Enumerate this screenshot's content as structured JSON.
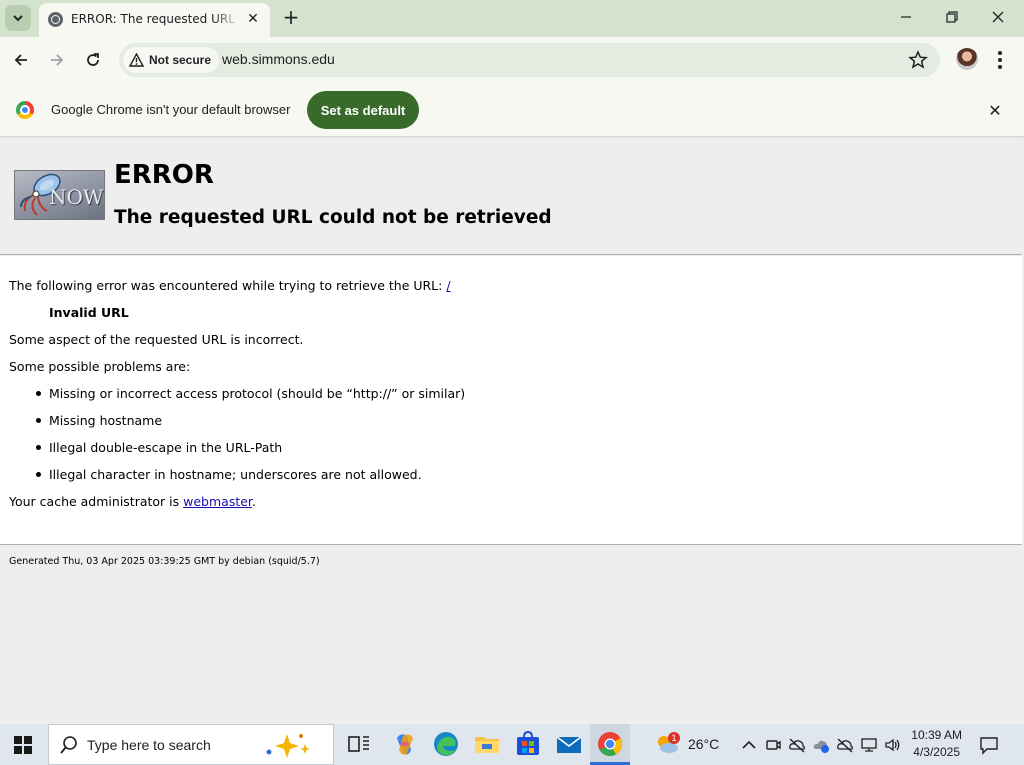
{
  "browser": {
    "tab_title": "ERROR: The requested URL could not be retrieved",
    "url": "web.simmons.edu",
    "security_label": "Not secure"
  },
  "infobar": {
    "message": "Google Chrome isn't your default browser",
    "button_label": "Set as default"
  },
  "page": {
    "logo_text": "NOW",
    "heading": "ERROR",
    "subheading": "The requested URL could not be retrieved",
    "intro_text": "The following error was encountered while trying to retrieve the URL:",
    "intro_link": "/",
    "error_title": "Invalid URL",
    "description": "Some aspect of the requested URL is incorrect.",
    "problems_intro": "Some possible problems are:",
    "problems": [
      "Missing or incorrect access protocol (should be “http://” or similar)",
      "Missing hostname",
      "Illegal double-escape in the URL-Path",
      "Illegal character in hostname; underscores are not allowed."
    ],
    "admin_text": "Your cache administrator is",
    "admin_link": "webmaster",
    "admin_suffix": ".",
    "generated": "Generated Thu, 03 Apr 2025 03:39:25 GMT by debian (squid/5.7)"
  },
  "taskbar": {
    "search_placeholder": "Type here to search",
    "weather_temp": "26°C",
    "weather_badge": "1",
    "clock_time": "10:39 AM",
    "clock_date": "4/3/2025"
  },
  "colors": {
    "titlebar": "#d3e3cd",
    "toolbar": "#f7f8f2",
    "set_default_button": "#386a2c",
    "link": "#1a0dab"
  }
}
